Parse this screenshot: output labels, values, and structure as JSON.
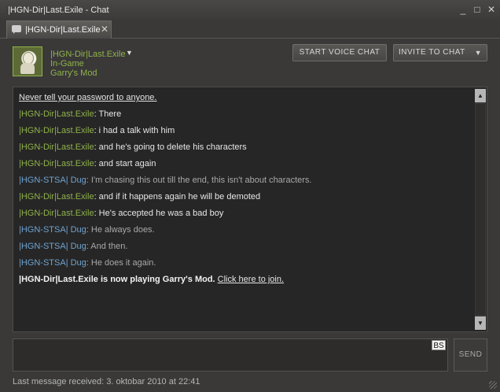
{
  "window": {
    "title": "|HGN-Dir|Last.Exile - Chat",
    "minimize_glyph": "_",
    "maximize_glyph": "□",
    "close_glyph": "✕"
  },
  "tab": {
    "label": "|HGN-Dir|Last.Exile",
    "close_glyph": "✕",
    "icon": "chat-bubble-icon"
  },
  "user": {
    "name": "|HGN-Dir|Last.Exile",
    "status": "In-Game",
    "game": "Garry's Mod",
    "dropdown_glyph": "▼",
    "name_color": "#8fb24a"
  },
  "buttons": {
    "voice_chat": "START VOICE CHAT",
    "invite": "INVITE TO CHAT",
    "invite_arrow": "▼"
  },
  "chat": {
    "notice": "Never tell your password to anyone.",
    "messages": [
      {
        "sender": "|HGN-Dir|Last.Exile",
        "text": ": There"
      },
      {
        "sender": "|HGN-Dir|Last.Exile",
        "text": ": i had a talk with him"
      },
      {
        "sender": "|HGN-Dir|Last.Exile",
        "text": ": and he's going to delete his characters"
      },
      {
        "sender": "|HGN-Dir|Last.Exile",
        "text": ": and start again"
      },
      {
        "sender": "|HGN-STSA| Dug",
        "text": ": I'm chasing this out till the end, this isn't about characters."
      },
      {
        "sender": "|HGN-Dir|Last.Exile",
        "text": ": and if it happens again he will be demoted"
      },
      {
        "sender": "|HGN-Dir|Last.Exile",
        "text": ": He's accepted he was a bad boy"
      },
      {
        "sender": "|HGN-STSA| Dug",
        "text": ": He always does."
      },
      {
        "sender": "|HGN-STSA| Dug",
        "text": ": And then."
      },
      {
        "sender": "|HGN-STSA| Dug",
        "text": ": He does it again."
      }
    ],
    "game_event_text": "|HGN-Dir|Last.Exile is now playing Garry's Mod.",
    "join_link": "Click here to join."
  },
  "input": {
    "bs_label": "BS",
    "send_label": "SEND"
  },
  "footer": {
    "last_message": "Last message received: 3. oktobar 2010 at 22:41"
  },
  "colors": {
    "self_name": "#8fb24a",
    "friend_name": "#6fa3d0",
    "background": "#3a3938",
    "chat_background": "#262626"
  }
}
